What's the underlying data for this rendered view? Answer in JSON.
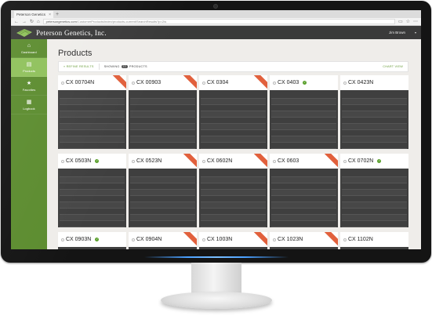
{
  "browser": {
    "tab_title": "Peterson Genetics",
    "url_host": "petersongenetics.com",
    "url_path": "/CustomerProducts/index/products-current/SearchResults?p=2/s"
  },
  "app": {
    "brand": "Peterson Genetics, Inc.",
    "user": "Jim Brown",
    "accent": "#8fc15b",
    "sidebar_color": "#5c8c2f",
    "ribbon_color": "#e1603c"
  },
  "sidebar": {
    "items": [
      {
        "label": "Dashboard",
        "icon": "home-icon",
        "glyph": "⌂"
      },
      {
        "label": "Products",
        "icon": "document-icon",
        "glyph": "▤"
      },
      {
        "label": "Favorites",
        "icon": "star-icon",
        "glyph": "★"
      },
      {
        "label": "Logbook",
        "icon": "calendar-icon",
        "glyph": "▦"
      }
    ]
  },
  "page": {
    "title": "Products"
  },
  "toolbar": {
    "refine": "« REFINE RESULTS",
    "showing_prefix": "SHOWING",
    "showing_count": "77",
    "showing_suffix": "PRODUCTS",
    "view": "CHART VIEW"
  },
  "products": {
    "row1": [
      {
        "name": "CX 00704N",
        "checked": false,
        "ribbon": true
      },
      {
        "name": "CX 00903",
        "checked": false,
        "ribbon": true
      },
      {
        "name": "CX 0304",
        "checked": false,
        "ribbon": true
      },
      {
        "name": "CX 0403",
        "checked": true,
        "ribbon": false
      },
      {
        "name": "CX 0423N",
        "checked": false,
        "ribbon": false
      }
    ],
    "row2": [
      {
        "name": "CX 0503N",
        "checked": true,
        "ribbon": false
      },
      {
        "name": "CX 0523N",
        "checked": false,
        "ribbon": true
      },
      {
        "name": "CX 0602N",
        "checked": false,
        "ribbon": true
      },
      {
        "name": "CX 0603",
        "checked": false,
        "ribbon": true
      },
      {
        "name": "CX 0702N",
        "checked": true,
        "ribbon": false
      }
    ],
    "row3": [
      {
        "name": "CX 0903N",
        "checked": true,
        "ribbon": false
      },
      {
        "name": "CX 0904N",
        "checked": false,
        "ribbon": true
      },
      {
        "name": "CX 1003N",
        "checked": false,
        "ribbon": true
      },
      {
        "name": "CX 1023N",
        "checked": false,
        "ribbon": true
      },
      {
        "name": "CX 1102N",
        "checked": false,
        "ribbon": false
      }
    ]
  }
}
